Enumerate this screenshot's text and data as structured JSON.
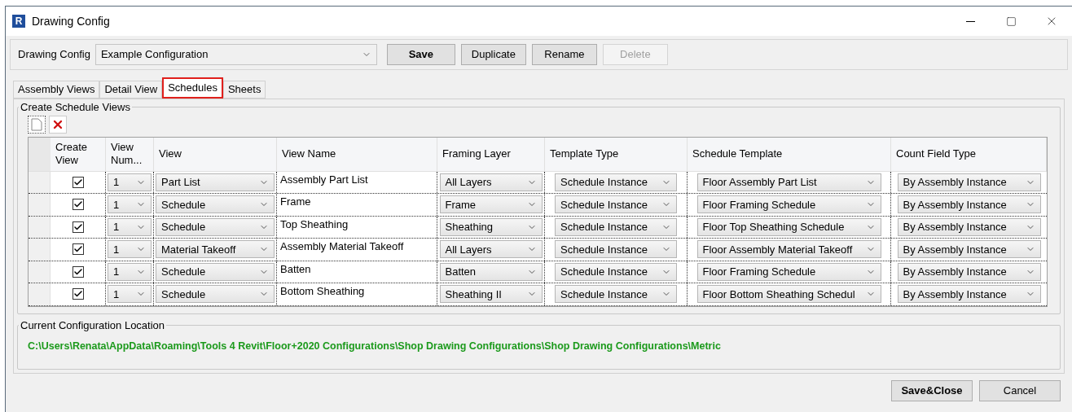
{
  "window": {
    "title": "Drawing Config",
    "icon_letter": "R"
  },
  "toolbar": {
    "label": "Drawing Config",
    "config_value": "Example Configuration",
    "buttons": [
      {
        "label": "Save",
        "bold": true,
        "disabled": false
      },
      {
        "label": "Duplicate",
        "bold": false,
        "disabled": false
      },
      {
        "label": "Rename",
        "bold": false,
        "disabled": false
      },
      {
        "label": "Delete",
        "bold": false,
        "disabled": true
      }
    ]
  },
  "tabs": [
    {
      "label": "Assembly Views",
      "selected": false
    },
    {
      "label": "Detail View",
      "selected": false
    },
    {
      "label": "Schedules",
      "selected": true
    },
    {
      "label": "Sheets",
      "selected": false
    }
  ],
  "schedule_group": {
    "title": "Create Schedule Views",
    "columns": [
      "Create View",
      "View Num...",
      "View",
      "View Name",
      "Framing Layer",
      "Template Type",
      "Schedule Template",
      "Count Field Type"
    ],
    "rows": [
      {
        "create_view": true,
        "view_number": "1",
        "view": "Part List",
        "view_name": "Assembly Part List",
        "framing_layer": "All Layers",
        "template_type": "Schedule Instance",
        "schedule_template": "Floor Assembly Part List",
        "count_field_type": "By Assembly Instance"
      },
      {
        "create_view": true,
        "view_number": "1",
        "view": "Schedule",
        "view_name": "Frame",
        "framing_layer": "Frame",
        "template_type": "Schedule Instance",
        "schedule_template": "Floor Framing Schedule",
        "count_field_type": "By Assembly Instance"
      },
      {
        "create_view": true,
        "view_number": "1",
        "view": "Schedule",
        "view_name": "Top Sheathing",
        "framing_layer": "Sheathing",
        "template_type": "Schedule Instance",
        "schedule_template": "Floor Top Sheathing Schedule",
        "count_field_type": "By Assembly Instance"
      },
      {
        "create_view": true,
        "view_number": "1",
        "view": "Material Takeoff",
        "view_name": "Assembly Material Takeoff",
        "framing_layer": "All Layers",
        "template_type": "Schedule Instance",
        "schedule_template": "Floor Assembly Material Takeoff",
        "count_field_type": "By Assembly Instance"
      },
      {
        "create_view": true,
        "view_number": "1",
        "view": "Schedule",
        "view_name": "Batten",
        "framing_layer": "Batten",
        "template_type": "Schedule Instance",
        "schedule_template": "Floor Framing Schedule",
        "count_field_type": "By Assembly Instance"
      },
      {
        "create_view": true,
        "view_number": "1",
        "view": "Schedule",
        "view_name": "Bottom Sheathing",
        "framing_layer": "Sheathing II",
        "template_type": "Schedule Instance",
        "schedule_template": "Floor Bottom Sheathing Schedul",
        "count_field_type": "By Assembly Instance"
      }
    ]
  },
  "location_group": {
    "title": "Current Configuration Location",
    "path": "C:\\Users\\Renata\\AppData\\Roaming\\Tools 4 Revit\\Floor+2020 Configurations\\Shop Drawing Configurations\\Shop Drawing Configurations\\Metric"
  },
  "footer_buttons": [
    {
      "label": "Save&Close",
      "bold": true
    },
    {
      "label": "Cancel",
      "bold": false
    }
  ]
}
